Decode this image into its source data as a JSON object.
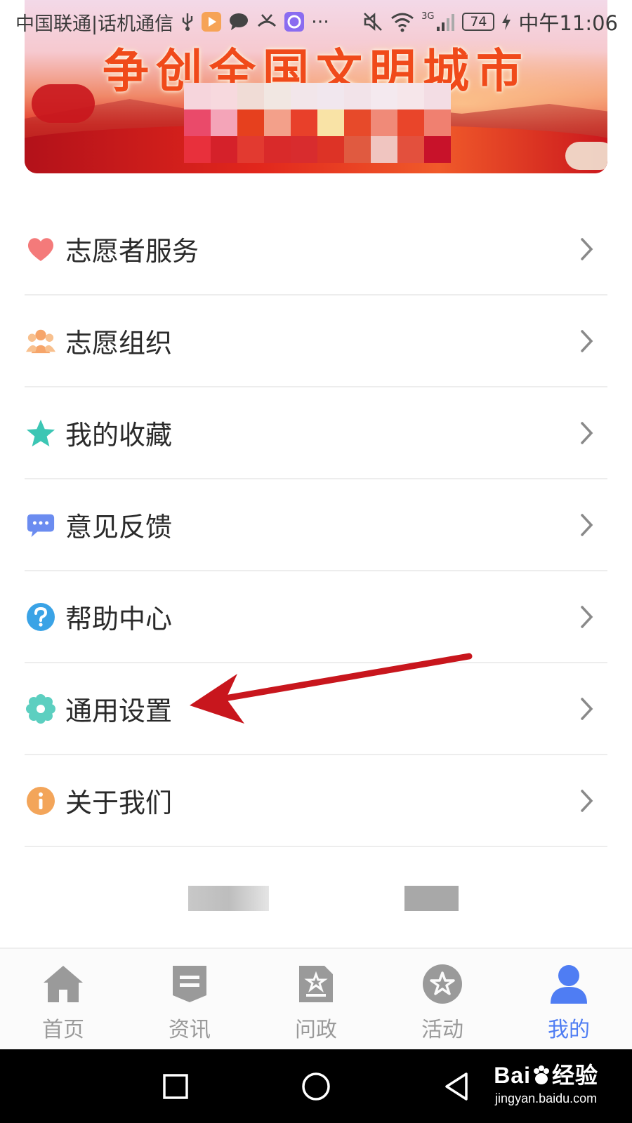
{
  "status_bar": {
    "carrier": "中国联通|话机通信",
    "battery": "74",
    "network": "3G",
    "time": "中午11:06",
    "more": "···"
  },
  "banner": {
    "title": "争创全国文明城市"
  },
  "menu": {
    "items": [
      {
        "label": "志愿者服务",
        "icon": "heart-icon",
        "color": "#f47a7a"
      },
      {
        "label": "志愿组织",
        "icon": "people-icon",
        "color": "#f6a56a"
      },
      {
        "label": "我的收藏",
        "icon": "star-icon",
        "color": "#3cc6b4"
      },
      {
        "label": "意见反馈",
        "icon": "chat-icon",
        "color": "#6b8cf0"
      },
      {
        "label": "帮助中心",
        "icon": "question-icon",
        "color": "#3aa3e6"
      },
      {
        "label": "通用设置",
        "icon": "gear-icon",
        "color": "#5ccfc0"
      },
      {
        "label": "关于我们",
        "icon": "info-icon",
        "color": "#f3a55a"
      }
    ]
  },
  "tabs": [
    {
      "label": "首页",
      "icon": "home-icon",
      "active": false
    },
    {
      "label": "资讯",
      "icon": "news-icon",
      "active": false
    },
    {
      "label": "问政",
      "icon": "inquiry-icon",
      "active": false
    },
    {
      "label": "活动",
      "icon": "activity-icon",
      "active": false
    },
    {
      "label": "我的",
      "icon": "profile-icon",
      "active": true
    }
  ],
  "colors": {
    "accent": "#4f7df3",
    "tab_inactive": "#9a9a9a",
    "annotation_arrow": "#c8161d"
  },
  "watermark": {
    "brand": "Bai",
    "brand_suffix": "经验",
    "url": "jingyan.baidu.com"
  }
}
